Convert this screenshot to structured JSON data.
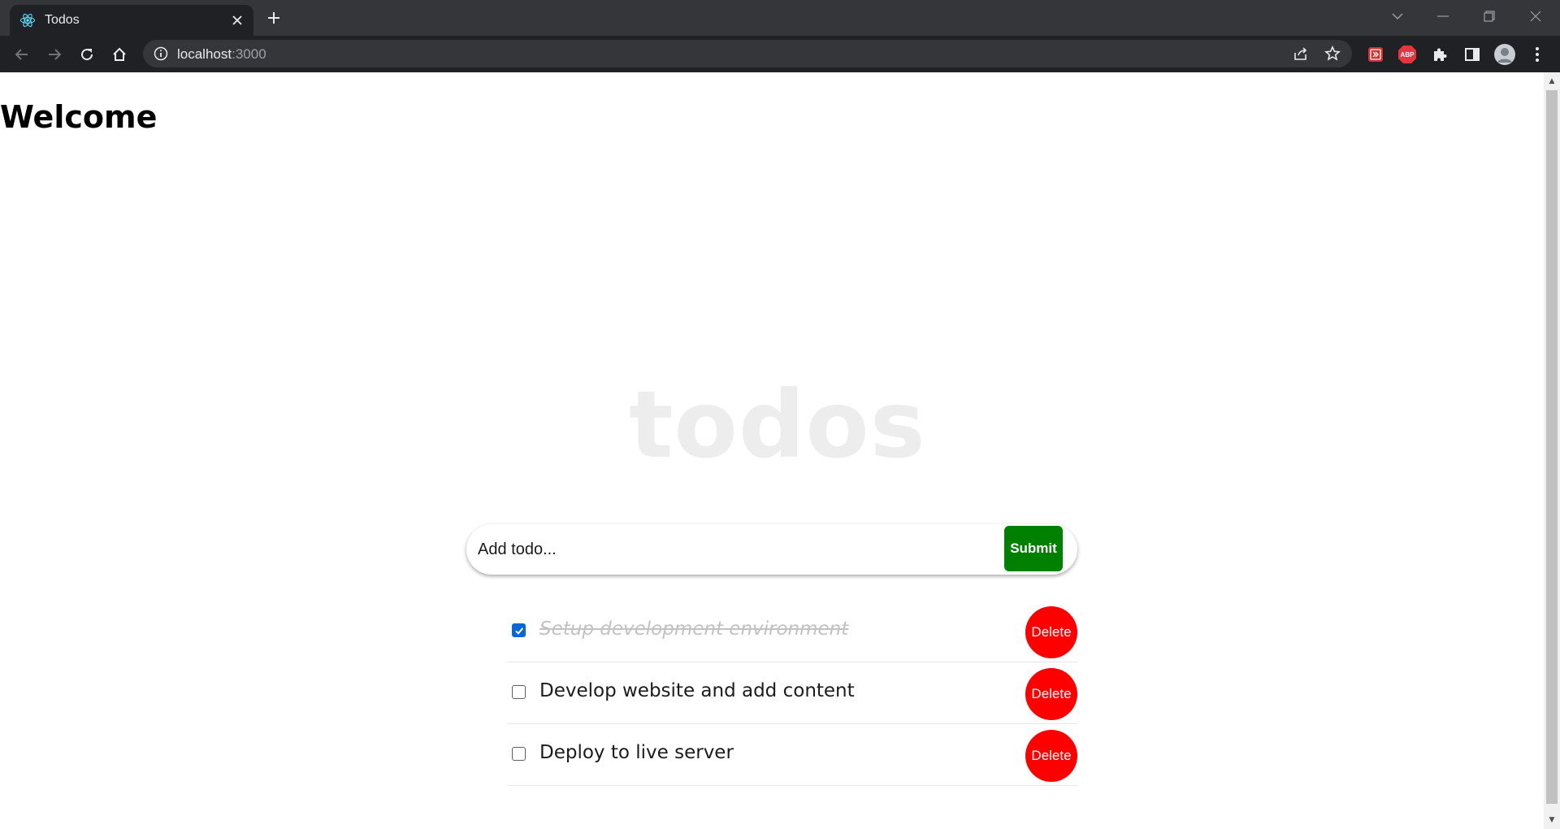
{
  "browser": {
    "tab": {
      "title": "Todos",
      "favicon": "react-icon"
    },
    "address_bar": {
      "host": "localhost",
      "port": ":3000"
    },
    "icons": [
      "back-icon",
      "forward-icon",
      "reload-icon",
      "home-icon",
      "site-info-icon",
      "share-icon",
      "bookmark-star-icon",
      "extensions-puzzle-icon",
      "side-panel-icon",
      "profile-avatar",
      "menu-kebab-icon"
    ],
    "extensions": {
      "abp_label": "ABP"
    }
  },
  "page": {
    "heading": "Welcome",
    "app_title": "todos",
    "add_form": {
      "placeholder": "Add todo...",
      "submit_label": "Submit"
    },
    "todos": [
      {
        "text": "Setup development environment",
        "completed": true,
        "delete_label": "Delete"
      },
      {
        "text": "Develop website and add content",
        "completed": false,
        "delete_label": "Delete"
      },
      {
        "text": "Deploy to live server",
        "completed": false,
        "delete_label": "Delete"
      }
    ]
  },
  "colors": {
    "submit": "#008000",
    "delete": "#ff0000",
    "checkbox_checked": "#0b67d8",
    "app_title": "#ededed"
  }
}
